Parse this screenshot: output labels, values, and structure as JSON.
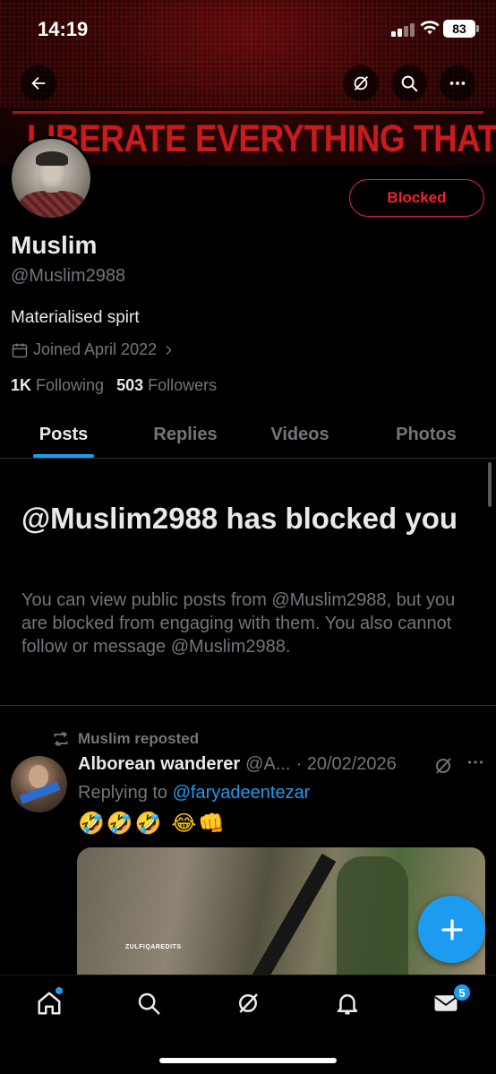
{
  "status_bar": {
    "time": "14:19",
    "battery": "83"
  },
  "banner": {
    "text": "LIBERATE EVERYTHING THAT EXISTS."
  },
  "profile": {
    "blocked_label": "Blocked",
    "name": "Muslim",
    "handle": "@Muslim2988",
    "bio": "Materialised spirt",
    "joined": "Joined April 2022",
    "following_count": "1K",
    "following_label": "Following",
    "followers_count": "503",
    "followers_label": "Followers"
  },
  "tabs": [
    {
      "label": "Posts",
      "active": true
    },
    {
      "label": "Replies",
      "active": false
    },
    {
      "label": "Videos",
      "active": false
    },
    {
      "label": "Photos",
      "active": false
    }
  ],
  "blocked_notice": {
    "title": "@Muslim2988 has blocked you",
    "body": "You can view public posts from @Muslim2988, but you are blocked from engaging with them. You also cannot follow or message @Muslim2988."
  },
  "post": {
    "repost_label": "Muslim reposted",
    "author_name": "Alborean wanderer",
    "author_handle": "@A...",
    "date": "· 20/02/2026",
    "replying_prefix": "Replying to",
    "replying_to": "@faryadeentezar",
    "emojis": "🤣🤣🤣 😂👊",
    "media_caption": "ZULFIQAREDITS"
  },
  "bottom_nav": {
    "messages_badge": "5"
  },
  "colors": {
    "accent": "#1d9bf0",
    "blocked_red": "#f4212e",
    "muted": "#71767b"
  },
  "icons": [
    "back-arrow-icon",
    "grok-icon",
    "search-icon",
    "more-icon",
    "calendar-icon",
    "chevron-right-icon",
    "repost-icon",
    "plus-icon",
    "home-icon",
    "bell-icon",
    "mail-icon"
  ]
}
